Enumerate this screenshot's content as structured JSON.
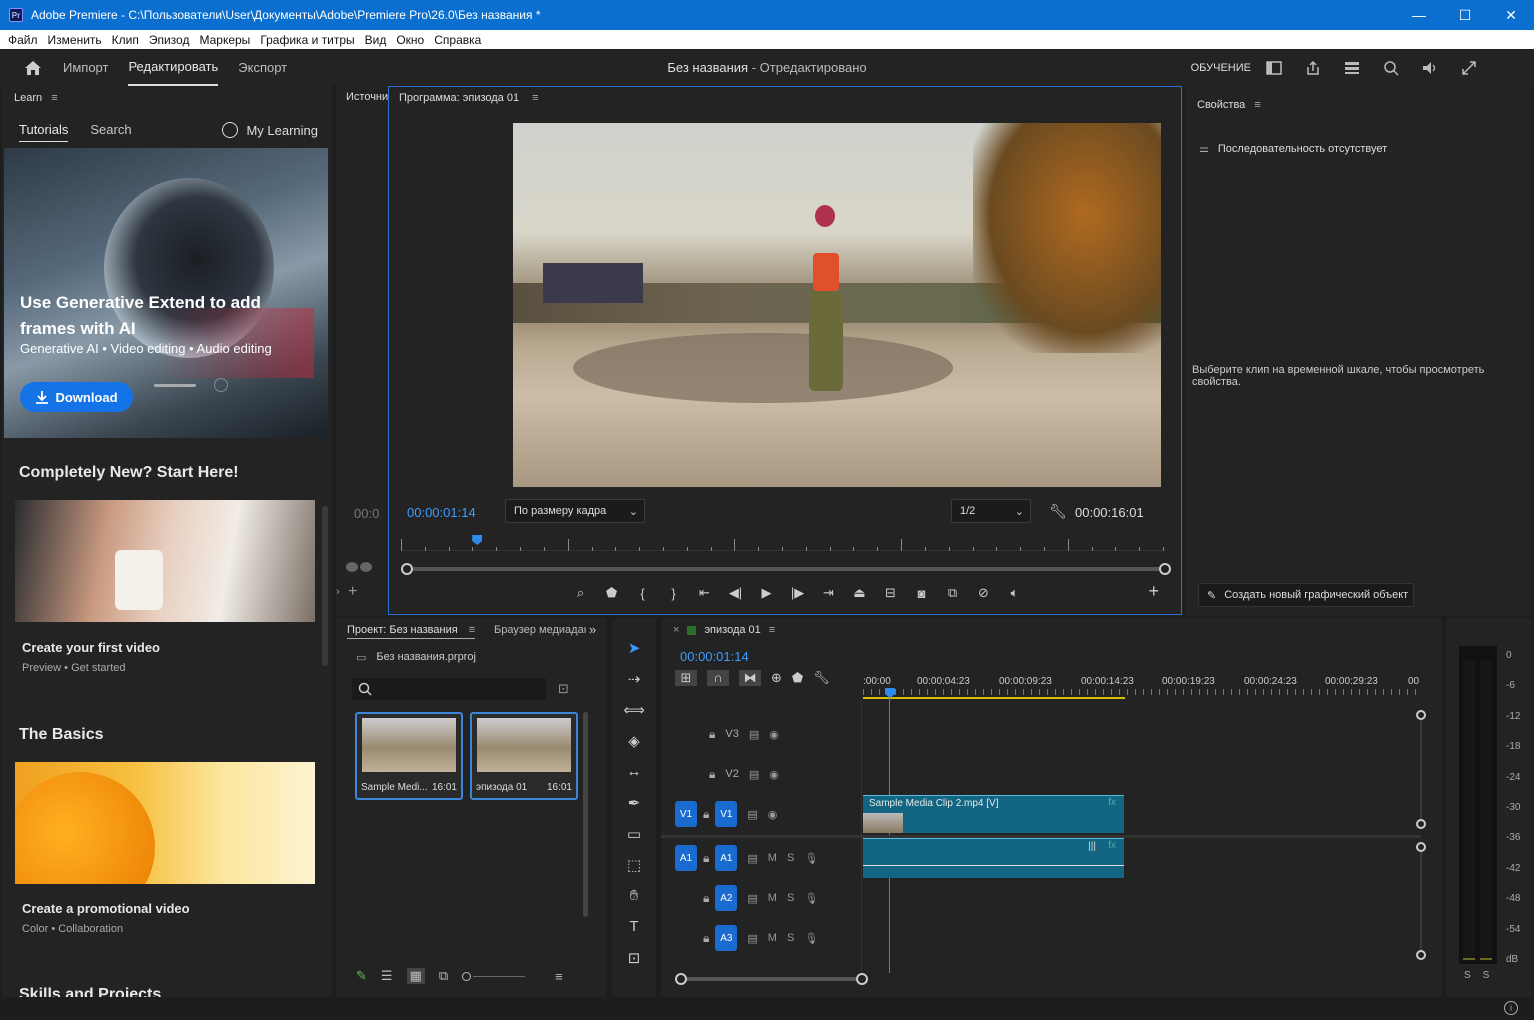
{
  "titlebar": {
    "title": "Adobe Premiere - C:\\Пользователи\\User\\Документы\\Adobe\\Premiere Pro\\26.0\\Без названия *",
    "app_badge": "Pr",
    "minimize": "—",
    "maximize": "☐",
    "close": "✕"
  },
  "menu": [
    "Файл",
    "Изменить",
    "Клип",
    "Эпизод",
    "Маркеры",
    "Графика и титры",
    "Вид",
    "Окно",
    "Справка"
  ],
  "workspace": {
    "tabs": [
      "Импорт",
      "Редактировать",
      "Экспорт"
    ],
    "active": "Редактировать",
    "doc_name": "Без названия",
    "doc_status": " - Отредактировано",
    "learn_label": "ОБУЧЕНИЕ"
  },
  "learn": {
    "header": "Learn",
    "tabs": [
      "Tutorials",
      "Search"
    ],
    "my_learning": "My Learning",
    "hero": {
      "title": "Use Generative Extend to add frames with AI",
      "tags": "Generative AI  •  Video editing  •  Audio editing",
      "button": "Download"
    },
    "section1": "Completely New? Start Here!",
    "card1": {
      "title": "Create your first video",
      "sub": "Preview  •  Get started"
    },
    "section2": "The Basics",
    "card2": {
      "title": "Create a promotional video",
      "sub": "Color  •  Collaboration"
    },
    "section3": "Skills and Projects"
  },
  "source_tab": "Источни",
  "program": {
    "tab": "Программа: эпизода 01",
    "timecode_left_cut": "00:0",
    "timecode": "00:00:01:14",
    "fit": "По размеру кадра",
    "resolution": "1/2",
    "duration": "00:00:16:01",
    "playhead_fraction": 0.1
  },
  "properties": {
    "tab": "Свойства",
    "no_sequence": "Последовательность отсутствует",
    "hint": "Выберите клип на временной шкале, чтобы просмотреть свойства.",
    "create_graphic": "Создать новый графический объект"
  },
  "project": {
    "tab": "Проект: Без названия",
    "tab2": "Браузер медиадан",
    "file": "Без названия.prproj",
    "search_placeholder": "",
    "items": [
      {
        "name": "Sample Medi...",
        "dur": "16:01"
      },
      {
        "name": "эпизода 01",
        "dur": "16:01"
      }
    ]
  },
  "timeline": {
    "tab": "эпизода 01",
    "timecode": "00:00:01:14",
    "ruler": [
      ":00:00",
      "00:00:04:23",
      "00:00:09:23",
      "00:00:14:23",
      "00:00:19:23",
      "00:00:24:23",
      "00:00:29:23",
      "00"
    ],
    "tracks": [
      {
        "name": "V3"
      },
      {
        "name": "V2"
      },
      {
        "name": "V1",
        "src": "V1"
      },
      {
        "name": "A1",
        "src": "A1"
      },
      {
        "name": "A2"
      },
      {
        "name": "A3"
      }
    ],
    "mute": "M",
    "solo": "S",
    "clip_label": "Sample Media Clip 2.mp4 [V]",
    "fx": "fx"
  },
  "meter": {
    "scale": [
      "0",
      "-6",
      "-12",
      "-18",
      "-24",
      "-30",
      "-36",
      "-42",
      "-48",
      "-54",
      "dB"
    ],
    "solo": [
      "S",
      "S"
    ]
  },
  "colors": {
    "accent": "#2d8ceb",
    "titlebar": "#0a6fcf",
    "clip": "#126683",
    "panel": "#232323"
  }
}
